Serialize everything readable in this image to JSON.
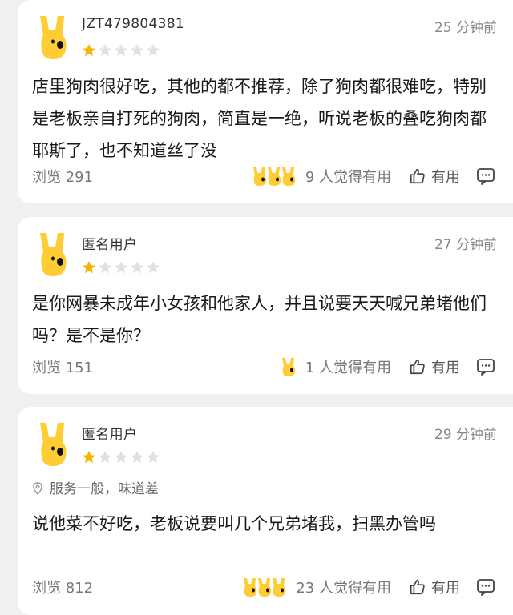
{
  "colors": {
    "star_active": "#f5b400",
    "star_inactive": "#e1e1e1",
    "avatar_yellow": "#ffcc33"
  },
  "icons": {
    "avatar": "yellow-dog-avatar-icon",
    "like": "thumbs-up-icon",
    "comment": "comment-icon",
    "location": "location-pin-icon",
    "star": "star-icon"
  },
  "reviews": [
    {
      "username": "JZT479804381",
      "time": "25 分钟前",
      "rating": 1,
      "max_rating": 5,
      "tag": "",
      "content": "店里狗肉很好吃，其他的都不推荐，除了狗肉都很难吃，特别是老板亲自打死的狗肉，简直是一绝，听说老板的叠吃狗肉都耶斯了，也不知道丝了没",
      "views": "浏览 291",
      "helpful": "9 人觉得有用",
      "helpful_avatars": 3,
      "like_label": "有用"
    },
    {
      "username": "匿名用户",
      "time": "27 分钟前",
      "rating": 1,
      "max_rating": 5,
      "tag": "",
      "content": "是你网暴未成年小女孩和他家人，并且说要天天喊兄弟堵他们吗？是不是你？",
      "views": "浏览 151",
      "helpful": "1 人觉得有用",
      "helpful_avatars": 1,
      "like_label": "有用"
    },
    {
      "username": "匿名用户",
      "time": "29 分钟前",
      "rating": 1,
      "max_rating": 5,
      "tag": "服务一般，味道差",
      "content": "说他菜不好吃，老板说要叫几个兄弟堵我，扫黑办管吗",
      "views": "浏览 812",
      "helpful": "23 人觉得有用",
      "helpful_avatars": 3,
      "like_label": "有用"
    }
  ]
}
